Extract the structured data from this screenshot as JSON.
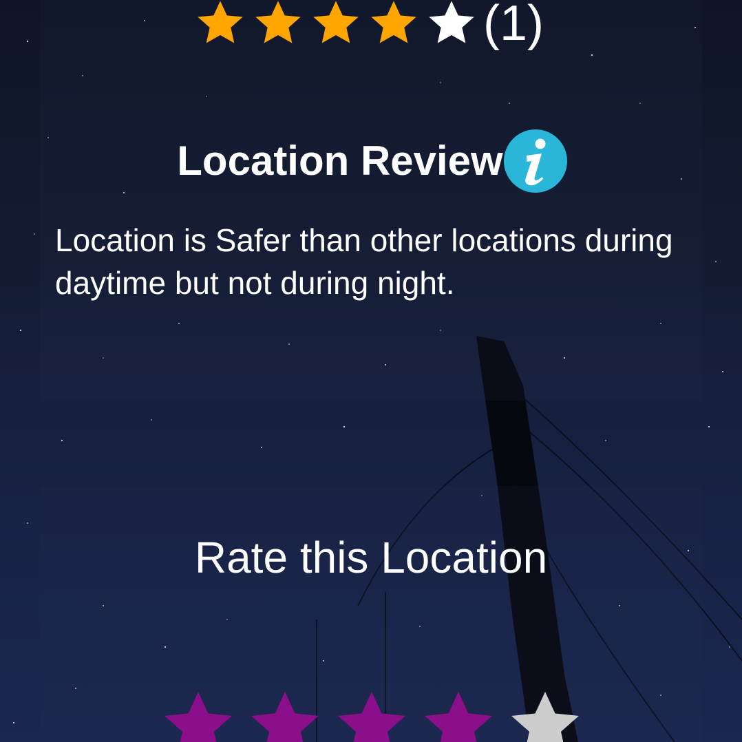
{
  "summary_rating": {
    "value": 4,
    "max": 5,
    "count_text": "(1)",
    "filled_color": "#FFA500",
    "empty_color": "#FFFFFF",
    "icon": "star-icon"
  },
  "review": {
    "title": "Location Review",
    "info_icon": "info-icon",
    "info_icon_color": "#29B6D8",
    "text": "Location is Safer than other locations during daytime but not during night."
  },
  "rate": {
    "title": "Rate this Location",
    "value": 4,
    "max": 5,
    "filled_color": "#8B0E8B",
    "empty_color": "#CCCCCC",
    "icon": "star-icon"
  }
}
